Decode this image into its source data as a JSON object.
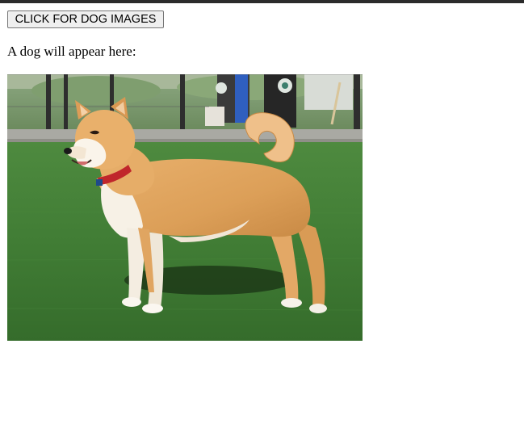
{
  "page": {
    "button_label": "CLICK FOR DOG IMAGES",
    "caption": "A dog will appear here:"
  },
  "image": {
    "subject": "dog-photo",
    "icon": "dog-image"
  },
  "colors": {
    "top_bar": "#2b2b2b",
    "button_bg": "#efefef",
    "button_border": "#767676",
    "grass": "#3f7a34",
    "dog_fur": "#e0a561"
  }
}
